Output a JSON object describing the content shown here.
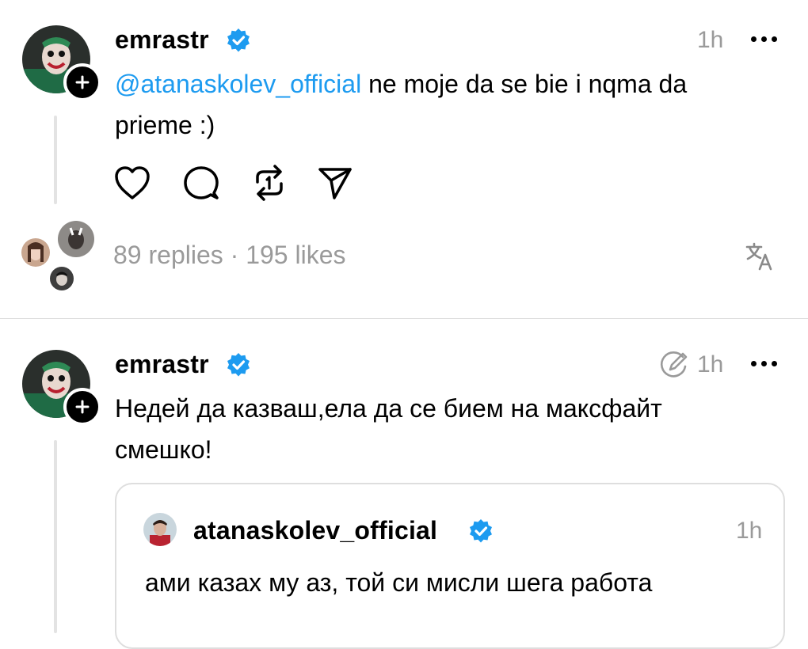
{
  "post1": {
    "username": "emrastr",
    "time": "1h",
    "mention": "@atanaskolev_official",
    "text_line1_rest": " ne moje da se bie i nqma da",
    "text_line2": "prieme :)",
    "stats": "89 replies · 195 likes"
  },
  "post2": {
    "username": "emrastr",
    "time": "1h",
    "text_line1": "Недей да казваш,ела да се бием на максфайт",
    "text_line2": "смешко!"
  },
  "quote": {
    "username": "atanaskolev_official",
    "time": "1h",
    "text": "ами казах му аз, той си мисли шега работа"
  },
  "icons": {
    "like": "heart-icon",
    "reply": "comment-icon",
    "repost": "repost-icon",
    "share": "send-icon",
    "translate": "translate-icon",
    "edited": "edited-icon",
    "verified": "verified-badge-icon",
    "more": "more-icon"
  },
  "colors": {
    "accent": "#1d9bf0",
    "muted": "#9a9a9a"
  }
}
